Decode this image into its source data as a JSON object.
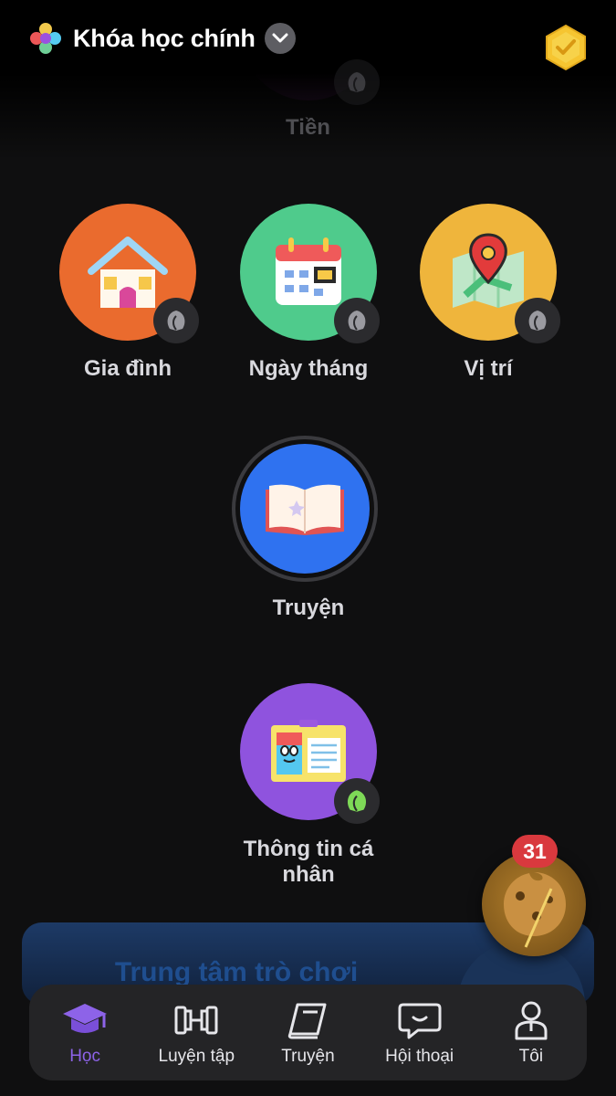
{
  "header": {
    "course_title": "Khóa học chính"
  },
  "path": {
    "faded_lesson": {
      "label": "Tiền",
      "icon": "piggy-bank-icon"
    },
    "lessons": [
      {
        "label": "Gia đình",
        "icon": "house-icon",
        "color": "#ea6b2e",
        "completed": false
      },
      {
        "label": "Ngày tháng",
        "icon": "calendar-icon",
        "color": "#4fcb8c",
        "completed": false
      },
      {
        "label": "Vị trí",
        "icon": "map-pin-icon",
        "color": "#efb53c",
        "completed": false
      },
      {
        "label": "Truyện",
        "icon": "open-book-icon",
        "color": "#2f72f0",
        "current": true
      },
      {
        "label": "Thông tin cá nhân",
        "icon": "id-card-icon",
        "color": "#8f53de",
        "completed": true
      }
    ],
    "games_banner": {
      "title": "Trung tâm trò chơi"
    },
    "reward": {
      "count": "31",
      "icon": "cookie-icon"
    }
  },
  "tabs": [
    {
      "label": "Học",
      "icon": "graduation-cap-icon",
      "active": true
    },
    {
      "label": "Luyện tập",
      "icon": "dumbbell-icon",
      "active": false
    },
    {
      "label": "Truyện",
      "icon": "book-icon",
      "active": false
    },
    {
      "label": "Hội thoại",
      "icon": "chat-bubble-icon",
      "active": false
    },
    {
      "label": "Tôi",
      "icon": "person-icon",
      "active": false
    }
  ],
  "colors": {
    "background": "#0f0f10",
    "active_tab": "#8d63e8",
    "completed_leaf": "#7ed957",
    "badge_red": "#d9393e"
  }
}
